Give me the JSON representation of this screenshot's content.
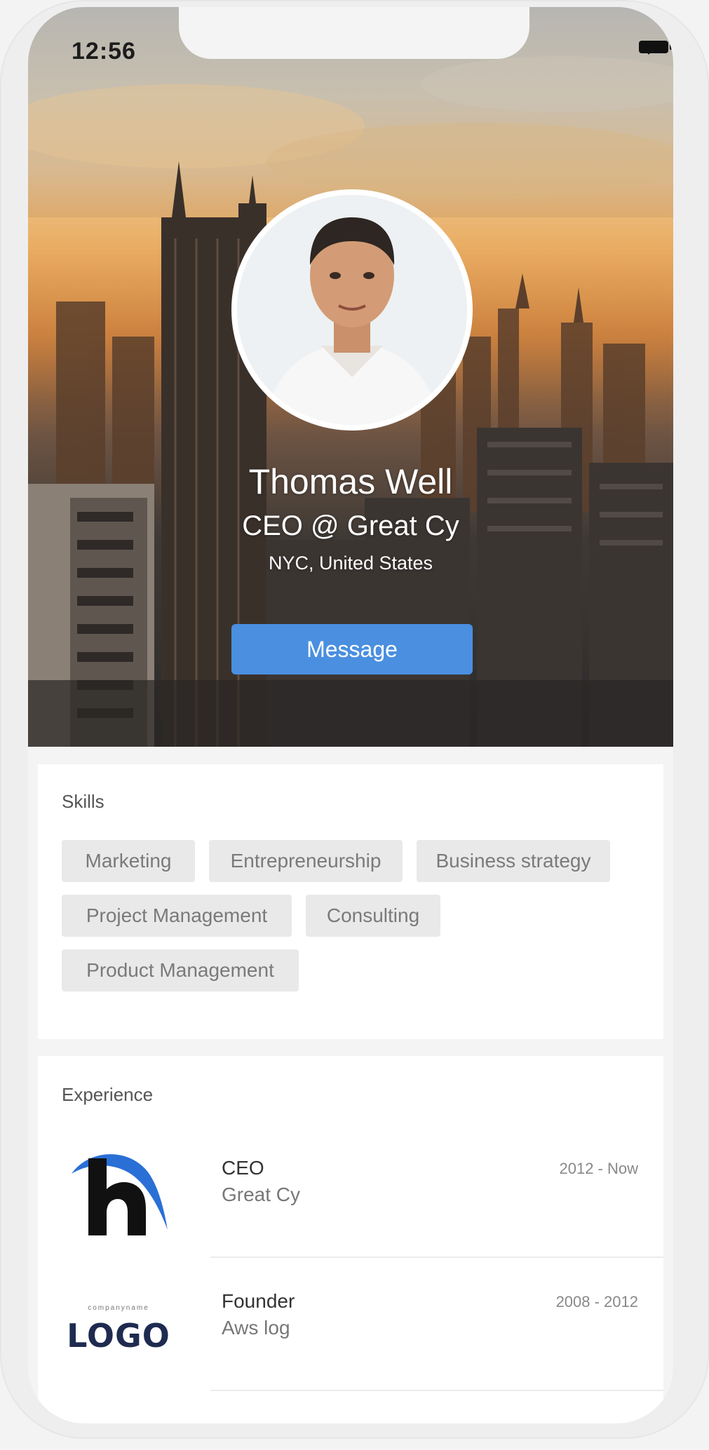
{
  "status_bar": {
    "time": "12:56",
    "icons": [
      "wifi-icon",
      "battery-icon"
    ]
  },
  "profile": {
    "name": "Thomas Well",
    "title": "CEO @ Great Cy",
    "location": "NYC, United States",
    "avatar_icon": "avatar-photo",
    "message_label": "Message"
  },
  "skills": {
    "title": "Skills",
    "items": [
      "Marketing",
      "Entrepreneurship",
      "Business strategy",
      "Project Management",
      "Consulting",
      "Product Management"
    ]
  },
  "experience": {
    "title": "Experience",
    "items": [
      {
        "role": "CEO",
        "company": "Great Cy",
        "dates": "2012 - Now",
        "logo": "h-logo-icon"
      },
      {
        "role": "Founder",
        "company": "Aws log",
        "dates": "2008 - 2012",
        "logo": "logo-wordmark",
        "logo_text": "LOGO",
        "logo_tagline": "companyname"
      }
    ]
  },
  "colors": {
    "accent": "#4a8fe0",
    "chip_bg": "#e9e9e9",
    "logo_navy": "#1e2a4f"
  }
}
